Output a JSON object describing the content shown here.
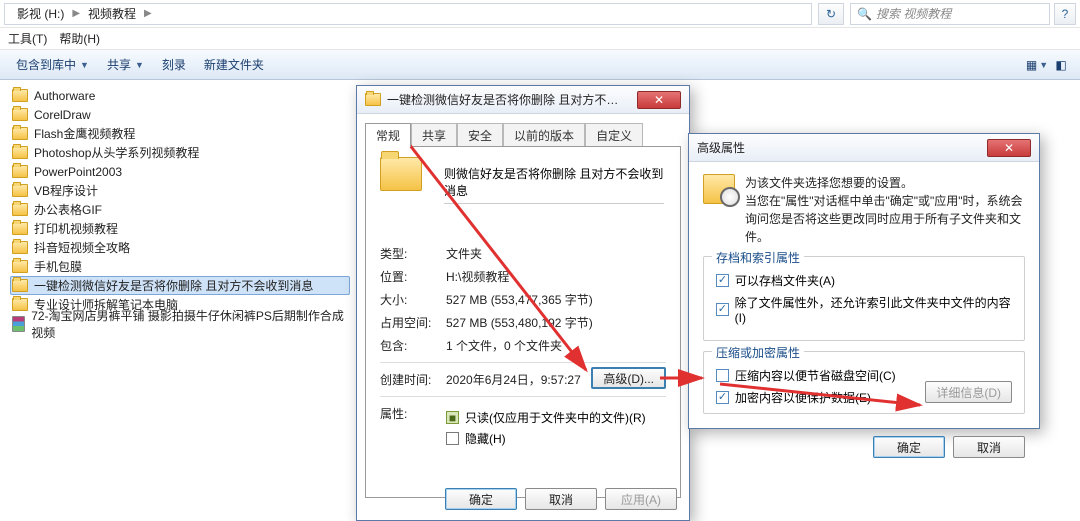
{
  "addressbar": {
    "root": "影视 (H:)",
    "folder": "视频教程",
    "search_placeholder": "搜索 视频教程",
    "refresh_glyph": "↻",
    "help_glyph": "?"
  },
  "menubar": {
    "tools": "工具(T)",
    "help": "帮助(H)"
  },
  "toolbar": {
    "include": "包含到库中",
    "share": "共享",
    "burn": "刻录",
    "newfolder": "新建文件夹"
  },
  "folders": [
    {
      "name": "Authorware",
      "icon": "folder"
    },
    {
      "name": "CorelDraw",
      "icon": "folder"
    },
    {
      "name": "Flash金鹰视频教程",
      "icon": "folder"
    },
    {
      "name": "Photoshop从头学系列视频教程",
      "icon": "folder"
    },
    {
      "name": "PowerPoint2003",
      "icon": "folder"
    },
    {
      "name": "VB程序设计",
      "icon": "folder"
    },
    {
      "name": "办公表格GIF",
      "icon": "folder"
    },
    {
      "name": "打印机视频教程",
      "icon": "folder"
    },
    {
      "name": "抖音短视频全攻略",
      "icon": "folder"
    },
    {
      "name": "手机包膜",
      "icon": "folder"
    },
    {
      "name": "一键检测微信好友是否将你删除 且对方不会收到消息",
      "icon": "folder",
      "selected": true
    },
    {
      "name": "专业设计师拆解笔记本电脑",
      "icon": "folder"
    },
    {
      "name": "72-淘宝网店男裤平铺 摄影拍摄牛仔休闲裤PS后期制作合成 视频",
      "icon": "rar"
    }
  ],
  "properties": {
    "title": "一键检测微信好友是否将你删除 且对方不会收到消息 ...",
    "tabs": {
      "general": "常规",
      "share": "共享",
      "security": "安全",
      "prev": "以前的版本",
      "custom": "自定义"
    },
    "name": "则微信好友是否将你删除  且对方不会收到消息",
    "rows": {
      "type_k": "类型:",
      "type_v": "文件夹",
      "loc_k": "位置:",
      "loc_v": "H:\\视频教程",
      "size_k": "大小:",
      "size_v": "527 MB (553,477,365 字节)",
      "disk_k": "占用空间:",
      "disk_v": "527 MB (553,480,192 字节)",
      "contains_k": "包含:",
      "contains_v": "1 个文件，0 个文件夹",
      "created_k": "创建时间:",
      "created_v": "2020年6月24日，9:57:27",
      "attr_k": "属性:"
    },
    "readonly": "只读(仅应用于文件夹中的文件)(R)",
    "hidden": "隐藏(H)",
    "advanced": "高级(D)...",
    "ok": "确定",
    "cancel": "取消",
    "apply": "应用(A)"
  },
  "advanced": {
    "title": "高级属性",
    "line1": "为该文件夹选择您想要的设置。",
    "line2": "当您在\"属性\"对话框中单击\"确定\"或\"应用\"时，系统会询问您是否将这些更改同时应用于所有子文件夹和文件。",
    "grp1": "存档和索引属性",
    "archive": "可以存档文件夹(A)",
    "index": "除了文件属性外，还允许索引此文件夹中文件的内容(I)",
    "grp2": "压缩或加密属性",
    "compress": "压缩内容以便节省磁盘空间(C)",
    "encrypt": "加密内容以便保护数据(E)",
    "details": "详细信息(D)",
    "ok": "确定",
    "cancel": "取消"
  }
}
